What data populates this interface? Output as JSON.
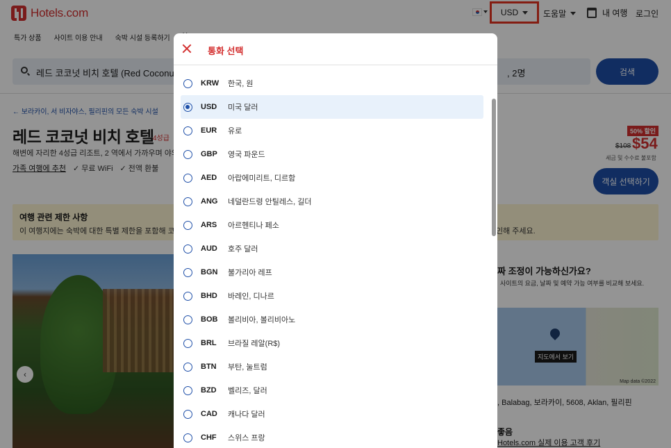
{
  "header": {
    "logo_text": "Hotels.com",
    "currency_label": "USD",
    "help_label": "도움말",
    "trips_label": "내 여행",
    "login_label": "로그인"
  },
  "subnav": [
    "특가 상품",
    "사이트 이용 안내",
    "숙박 시설 등록하기",
    "Ho"
  ],
  "search": {
    "destination_text": "레드 코코넛 비치 호텔 (Red Coconut",
    "guests_text": ", 2명",
    "button_label": "검색"
  },
  "hotel": {
    "breadcrumb": "← 보라카이, 서 비자야스, 필리핀의 모든 숙박 시설",
    "title": "레드 코코넛 비치 호텔",
    "stars": "4성급",
    "subtitle": "해변에 자리한 4성급 리조트, 2 역에서 가까우며 야외",
    "features": [
      "가족 여행에 추천",
      "✓ 무료 WiFi",
      "✓ 전액 환불"
    ],
    "discount_badge": "50% 할인",
    "old_price": "$108",
    "price": "$54",
    "tax_note": "세금 및 수수료 불포함",
    "room_button": "객실 선택하기"
  },
  "notice": {
    "title": "여행 관련 제한 사항",
    "body": "이 여행지에는 숙박에 대한 특별 제한을 포함해 코로",
    "tail": "인해 주세요."
  },
  "sidebar": {
    "question": "짜 조정이 가능하신가요?",
    "question_sub": "사이트의 요금, 날짜 및 예약 가능 여부를 비교해 보세요.",
    "map_label": "지도에서 보기",
    "map_copyright": "Map data ©2022",
    "address": ", Balabag, 보라카이, 5608, Aklan, 필리핀",
    "review_title": "좋음",
    "review_link": "Hotels.com 실제 이용 고객 후기"
  },
  "modal": {
    "title": "통화 선택",
    "selected_code": "USD",
    "options": [
      {
        "code": "KRW",
        "name": "한국, 원"
      },
      {
        "code": "USD",
        "name": "미국 달러"
      },
      {
        "code": "EUR",
        "name": "유로"
      },
      {
        "code": "GBP",
        "name": "영국 파운드"
      },
      {
        "code": "AED",
        "name": "아랍에미리트, 디르함"
      },
      {
        "code": "ANG",
        "name": "네덜란드령 안틸레스, 길더"
      },
      {
        "code": "ARS",
        "name": "아르헨티나 페소"
      },
      {
        "code": "AUD",
        "name": "호주 달러"
      },
      {
        "code": "BGN",
        "name": "불가리아 레프"
      },
      {
        "code": "BHD",
        "name": "바레인, 디나르"
      },
      {
        "code": "BOB",
        "name": "볼리비아, 볼리비아노"
      },
      {
        "code": "BRL",
        "name": "브라질 레알(R$)"
      },
      {
        "code": "BTN",
        "name": "부탄, 눌트럼"
      },
      {
        "code": "BZD",
        "name": "벨리즈, 달러"
      },
      {
        "code": "CAD",
        "name": "캐나다 달러"
      },
      {
        "code": "CHF",
        "name": "스위스 프랑"
      }
    ]
  },
  "colors": {
    "brand_red": "#d32f2f",
    "accent_blue": "#1e4fa8",
    "highlight_box": "#e3331f",
    "selected_row": "#e8f1fb"
  }
}
